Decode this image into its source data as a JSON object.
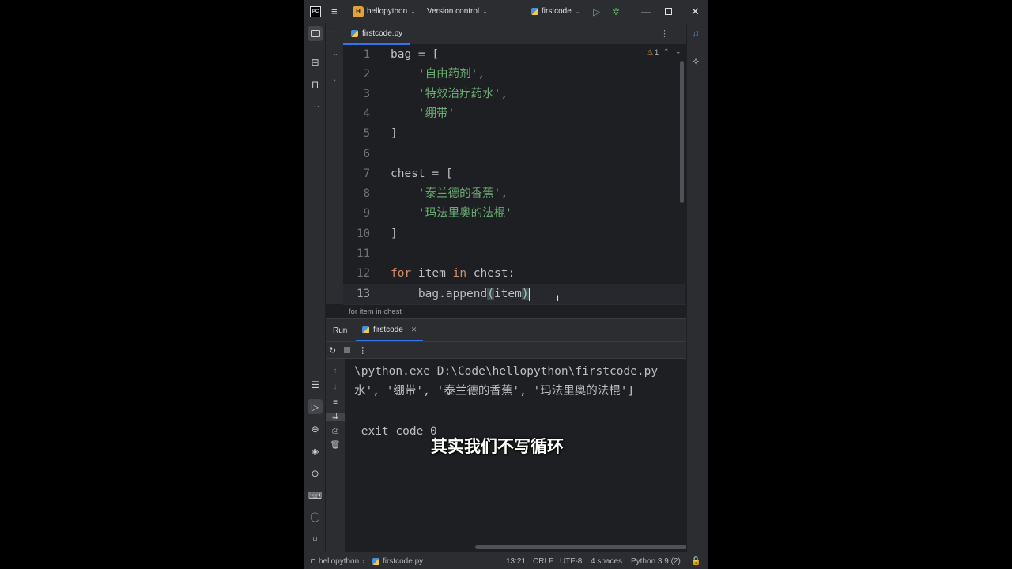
{
  "titlebar": {
    "project_badge": "H",
    "project": "hellopython",
    "vcs": "Version control",
    "run_config": "firstcode"
  },
  "editor": {
    "tab_label": "firstcode.py",
    "warnings": "1",
    "breadcrumb": "for item in chest",
    "lines": [
      {
        "n": "1"
      },
      {
        "n": "2"
      },
      {
        "n": "3"
      },
      {
        "n": "4"
      },
      {
        "n": "5"
      },
      {
        "n": "6"
      },
      {
        "n": "7"
      },
      {
        "n": "8"
      },
      {
        "n": "9"
      },
      {
        "n": "10"
      },
      {
        "n": "11"
      },
      {
        "n": "12"
      },
      {
        "n": "13"
      }
    ],
    "code": {
      "l1": "bag = [",
      "l2": "    '自由药剂',",
      "l3": "    '特效治疗药水',",
      "l4": "    '绷带'",
      "l5": "]",
      "l7": "chest = [",
      "l8": "    '泰兰德的香蕉',",
      "l9": "    '玛法里奥的法棍'",
      "l10": "]",
      "l12_kw1": "for",
      "l12_mid": " item ",
      "l12_kw2": "in",
      "l12_rest": " chest:",
      "l13_a": "    bag.append",
      "l13_p1": "(",
      "l13_b": "item",
      "l13_p2": ")"
    }
  },
  "run": {
    "tab_run": "Run",
    "tab_config": "firstcode",
    "console": [
      "\\python.exe D:\\Code\\hellopython\\firstcode.py",
      "水', '绷带', '泰兰德的香蕉', '玛法里奥的法棍']",
      "",
      " exit code 0"
    ]
  },
  "subtitle": "其实我们不写循环",
  "statusbar": {
    "project": "hellopython",
    "file": "firstcode.py",
    "position": "13:21",
    "line_sep": "CRLF",
    "encoding": "UTF-8",
    "indent": "4 spaces",
    "interpreter": "Python 3.9 (2)"
  },
  "colors": {
    "accent": "#3574f0",
    "keyword": "#cf8e6d",
    "string": "#6aab73",
    "background": "#1e1f22"
  }
}
